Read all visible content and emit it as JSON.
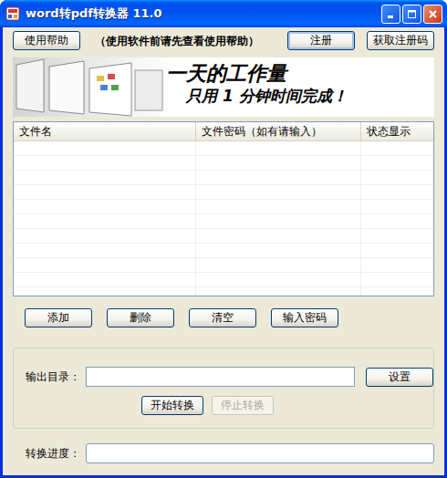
{
  "window": {
    "title": "word转pdf转换器 11.0"
  },
  "toolbar": {
    "help_button": "使用帮助",
    "hint": "（使用软件前请先查看使用帮助）",
    "buttons": [
      {
        "label": "注册",
        "focused": true
      },
      {
        "label": "获取注册码",
        "focused": false
      }
    ]
  },
  "banner": {
    "headline": "一天的工作量",
    "subline": "只用 1 分钟时间完成！"
  },
  "table": {
    "columns": [
      "文件名",
      "文件密码（如有请输入）",
      "状态显示"
    ],
    "rows": []
  },
  "list_buttons": [
    "添加",
    "删除",
    "清空",
    "输入密码"
  ],
  "output": {
    "label": "输出目录：",
    "button": "设置"
  },
  "actions": [
    {
      "label": "开始转换",
      "disabled": false
    },
    {
      "label": "停止转换",
      "disabled": true
    }
  ],
  "progress": {
    "label": "转换进度：",
    "level": 0
  }
}
